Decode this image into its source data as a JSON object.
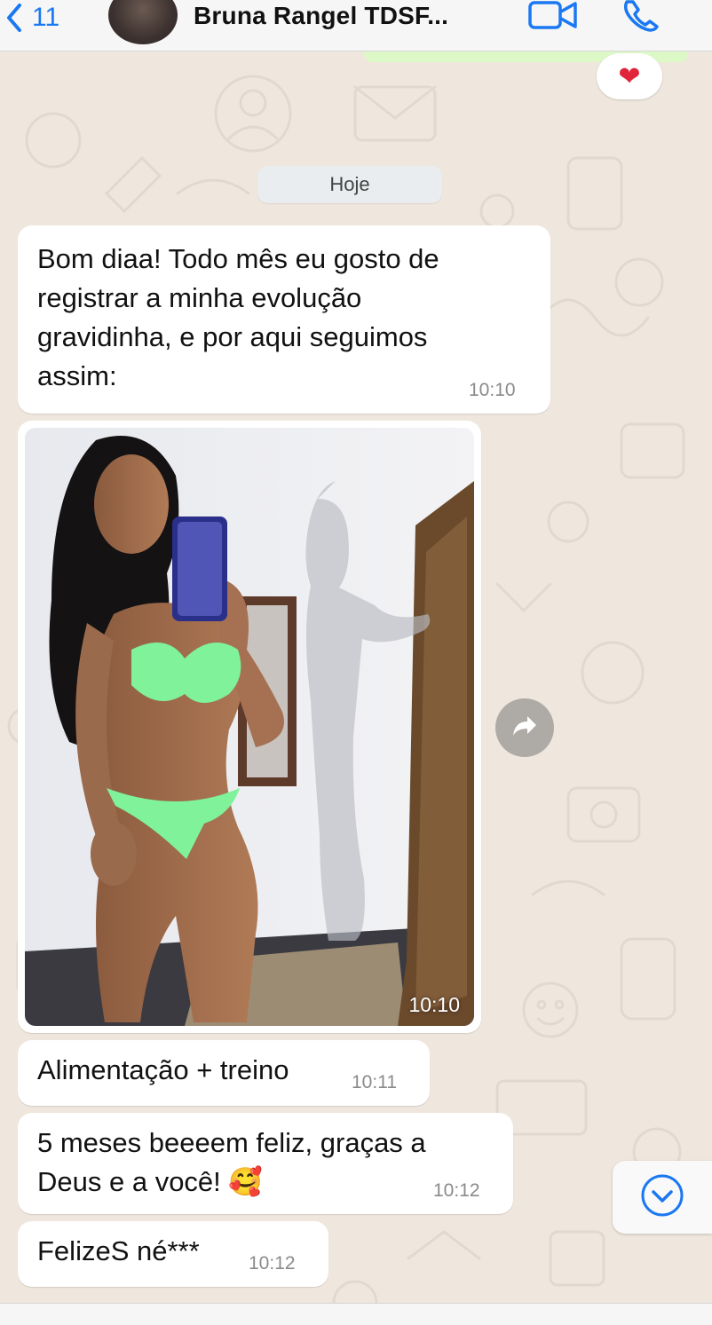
{
  "header": {
    "back_count": "11",
    "contact_name": "Bruna Rangel TDSF...",
    "back_icon": "chevron-left-icon",
    "video_icon": "video-camera-icon",
    "call_icon": "phone-icon"
  },
  "reaction": {
    "emoji": "❤"
  },
  "date_separator": "Hoje",
  "messages": [
    {
      "lines": [
        "Bom diaa! Todo mês eu gosto de",
        "registrar a minha evolução",
        "gravidinha, e por aqui seguimos",
        "assim:"
      ],
      "time": "10:10"
    },
    {
      "type": "image",
      "time": "10:10"
    },
    {
      "text": "Alimentação + treino",
      "time": "10:11"
    },
    {
      "lines": [
        "5 meses beeeem feliz, graças a",
        "Deus e a você! 🥰"
      ],
      "time": "10:12"
    },
    {
      "text": "FelizeS né***",
      "time": "10:12"
    }
  ],
  "colors": {
    "accent": "#1a78f2",
    "background": "#efe7dd",
    "bubble": "#ffffff",
    "sent_bubble": "#dcf8c6"
  }
}
